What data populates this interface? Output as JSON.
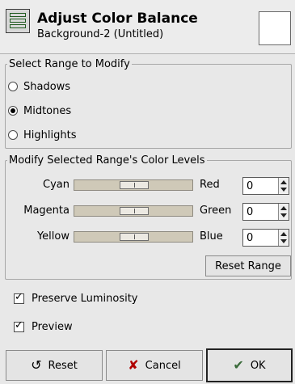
{
  "header": {
    "title": "Adjust Color Balance",
    "subtitle": "Background-2 (Untitled)",
    "icon": "color-balance-icon"
  },
  "range_group": {
    "legend": "Select Range to Modify",
    "options": [
      {
        "label": "Shadows",
        "selected": false
      },
      {
        "label": "Midtones",
        "selected": true
      },
      {
        "label": "Highlights",
        "selected": false
      }
    ]
  },
  "levels_group": {
    "legend": "Modify Selected Range's Color Levels",
    "rows": [
      {
        "left": "Cyan",
        "right": "Red",
        "value": "0"
      },
      {
        "left": "Magenta",
        "right": "Green",
        "value": "0"
      },
      {
        "left": "Yellow",
        "right": "Blue",
        "value": "0"
      }
    ],
    "reset_range": "Reset Range"
  },
  "options": {
    "preserve_luminosity": {
      "label": "Preserve Luminosity",
      "checked": true
    },
    "preview": {
      "label": "Preview",
      "checked": true
    }
  },
  "buttons": {
    "reset": "Reset",
    "cancel": "Cancel",
    "ok": "OK"
  }
}
